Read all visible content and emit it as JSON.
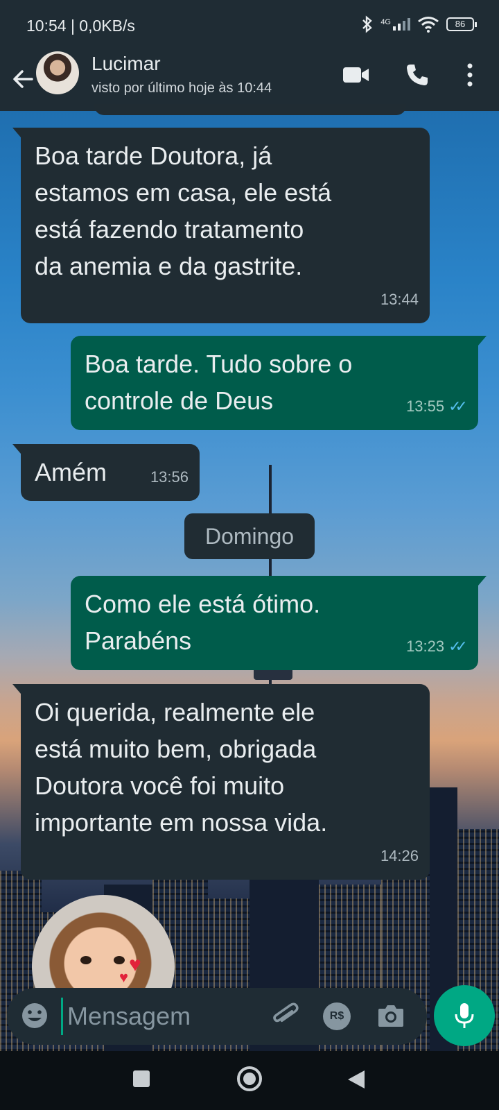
{
  "status_bar": {
    "time_speed": "10:54 | 0,0KB/s",
    "network": "4G",
    "battery": "86"
  },
  "header": {
    "contact_name": "Lucimar",
    "last_seen": "visto por último hoje às 10:44",
    "icons": [
      "back-arrow-icon",
      "video-call-icon",
      "voice-call-icon",
      "more-options-icon"
    ]
  },
  "messages": [
    {
      "direction": "in",
      "lines": [
        "Boa tarde Doutora, já",
        "estamos em casa, ele está",
        "está fazendo tratamento",
        "da anemia e da gastrite."
      ],
      "time": "13:44"
    },
    {
      "direction": "out",
      "lines": [
        "Boa tarde. Tudo sobre o",
        "controle de Deus"
      ],
      "time": "13:55",
      "ticks": "✓✓"
    },
    {
      "direction": "in",
      "lines": [
        "Amém"
      ],
      "time": "13:56"
    },
    {
      "direction": "out",
      "lines": [
        "Como ele está ótimo.",
        "Parabéns"
      ],
      "time": "13:23",
      "ticks": "✓✓"
    },
    {
      "direction": "in",
      "lines": [
        "Oi querida, realmente ele",
        "está  muito bem, obrigada",
        "Doutora você foi muito",
        "importante  em nossa vida."
      ],
      "time": "14:26"
    }
  ],
  "date_divider": "Domingo",
  "input": {
    "placeholder": "Mensagem",
    "payment_label": "R$",
    "icons": [
      "emoji-icon",
      "attach-icon",
      "payment-icon",
      "camera-icon",
      "mic-icon"
    ]
  },
  "nav_bar": {
    "icons": [
      "recents-icon",
      "home-icon",
      "back-icon"
    ]
  },
  "colors": {
    "header_bg": "#1f2c34",
    "incoming_bubble": "#202c33",
    "outgoing_bubble": "#005c4b",
    "accent": "#00a884",
    "read_ticks": "#53bdeb"
  }
}
